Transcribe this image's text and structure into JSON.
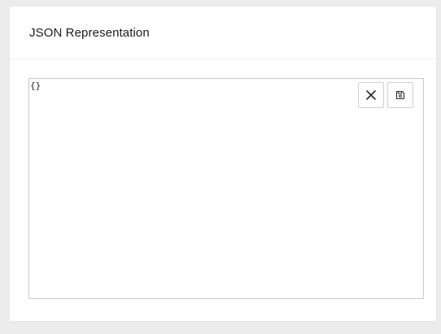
{
  "panel": {
    "title": "JSON Representation"
  },
  "editor": {
    "value": "{}"
  },
  "toolbar": {
    "clear_icon": "close-icon",
    "save_icon": "save-icon"
  }
}
